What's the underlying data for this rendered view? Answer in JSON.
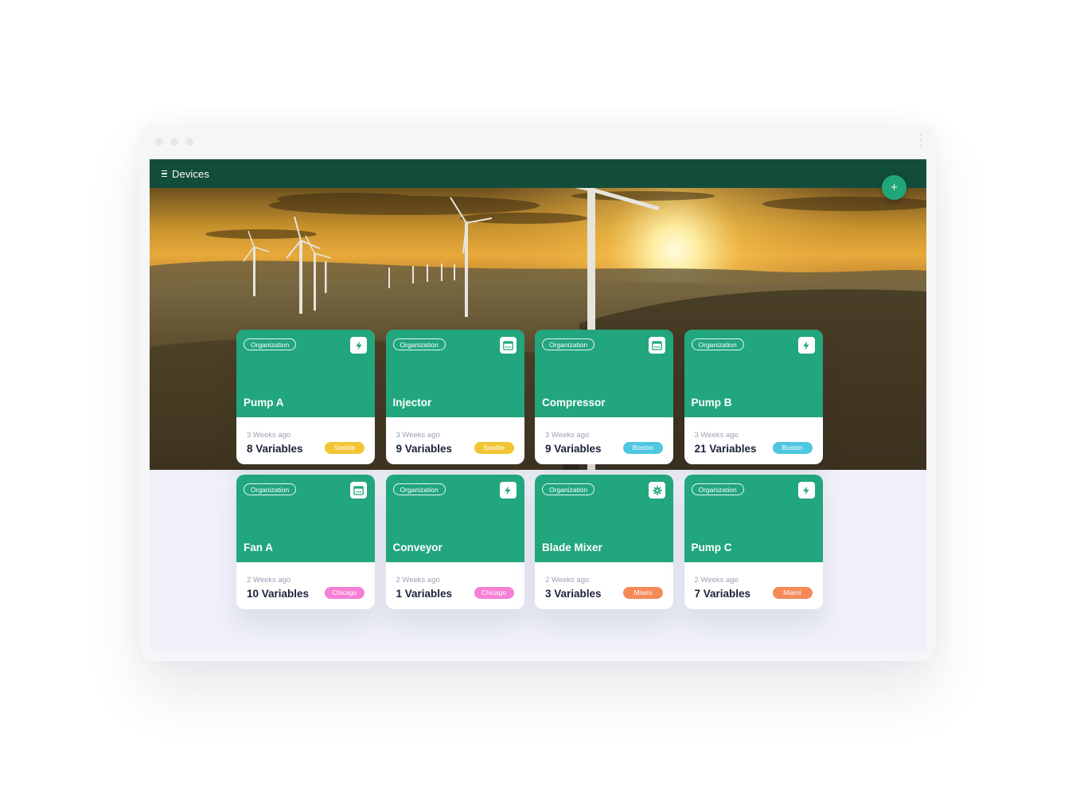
{
  "app": {
    "title": "Devices",
    "add_label": "+"
  },
  "colors": {
    "header": "#124d3c",
    "card": "#21a67d",
    "Seattle": "#f2c535",
    "Boston": "#4ec7df",
    "Chicago": "#f57fd4",
    "Miami": "#f48a57"
  },
  "cards": [
    {
      "org": "Organization",
      "name": "Pump A",
      "time": "3 Weeks ago",
      "vars": "8 Variables",
      "location": "Seattle",
      "icon": "lightning-icon"
    },
    {
      "org": "Organization",
      "name": "Injector",
      "time": "3 Weeks ago",
      "vars": "9 Variables",
      "location": "Seattle",
      "icon": "calendar-icon"
    },
    {
      "org": "Organization",
      "name": "Compressor",
      "time": "3 Weeks ago",
      "vars": "9 Variables",
      "location": "Boston",
      "icon": "calendar-icon"
    },
    {
      "org": "Organization",
      "name": "Pump B",
      "time": "3 Weeks ago",
      "vars": "21 Variables",
      "location": "Boston",
      "icon": "lightning-icon"
    },
    {
      "org": "Organization",
      "name": "Fan A",
      "time": "2 Weeks ago",
      "vars": "10 Variables",
      "location": "Chicago",
      "icon": "calendar-icon"
    },
    {
      "org": "Organization",
      "name": "Conveyor",
      "time": "2 Weeks ago",
      "vars": "1 Variables",
      "location": "Chicago",
      "icon": "lightning-icon"
    },
    {
      "org": "Organization",
      "name": "Blade Mixer",
      "time": "2 Weeks ago",
      "vars": "3 Variables",
      "location": "Miami",
      "icon": "gear-icon"
    },
    {
      "org": "Organization",
      "name": "Pump C",
      "time": "2 Weeks ago",
      "vars": "7 Variables",
      "location": "Miami",
      "icon": "lightning-icon"
    }
  ]
}
